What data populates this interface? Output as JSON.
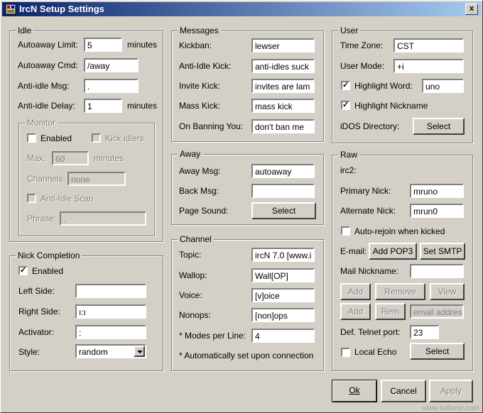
{
  "window": {
    "title": "IrcN Setup Settings",
    "close": "x"
  },
  "idle": {
    "legend": "Idle",
    "autoaway_limit_label": "Autoaway Limit:",
    "autoaway_limit_value": "5",
    "autoaway_limit_unit": "minutes",
    "autoaway_cmd_label": "Autoaway Cmd:",
    "autoaway_cmd_value": "/away",
    "antiidle_msg_label": "Anti-idle Msg:",
    "antiidle_msg_value": ".",
    "antiidle_delay_label": "Anti-idle Delay:",
    "antiidle_delay_value": "1",
    "antiidle_delay_unit": "minutes",
    "monitor": {
      "legend": "Monitor",
      "enabled_label": "Enabled",
      "kick_idlers_label": "Kick idlers",
      "max_label": "Max:",
      "max_value": "60",
      "max_unit": "minutes",
      "channels_label": "Channels:",
      "channels_value": "none",
      "antiidle_scan_label": "Anti-Idle Scan",
      "phrase_label": "Phrase:",
      "phrase_value": "."
    }
  },
  "nick": {
    "legend": "Nick Completion",
    "enabled_label": "Enabled",
    "left_label": "Left Side:",
    "left_value": "",
    "right_label": "Right Side:",
    "right_value": "ı:ı",
    "activator_label": "Activator:",
    "activator_value": ":",
    "style_label": "Style:",
    "style_value": "random"
  },
  "messages": {
    "legend": "Messages",
    "kickban_label": "Kickban:",
    "kickban_value": "lewser",
    "antiidle_kick_label": "Anti-Idle Kick:",
    "antiidle_kick_value": "anti-idles suck",
    "invite_kick_label": "Invite Kick:",
    "invite_kick_value": "invites are lam",
    "mass_kick_label": "Mass Kick:",
    "mass_kick_value": "mass kick",
    "banning_label": "On Banning You:",
    "banning_value": "don't ban me"
  },
  "away": {
    "legend": "Away",
    "away_msg_label": "Away Msg:",
    "away_msg_value": "autoaway",
    "back_msg_label": "Back Msg:",
    "back_msg_value": "",
    "page_sound_label": "Page Sound:",
    "select_label": "Select"
  },
  "channel": {
    "legend": "Channel",
    "topic_label": "Topic:",
    "topic_value": "ircN 7.0 [www.i",
    "wallop_label": "Wallop:",
    "wallop_value": "Wall[OP]",
    "voice_label": "Voice:",
    "voice_value": "[v]oice",
    "nonops_label": "Nonops:",
    "nonops_value": "[non]ops",
    "modes_label": "* Modes per Line:",
    "modes_value": "4",
    "note": "* Automatically set upon connection"
  },
  "user": {
    "legend": "User",
    "timezone_label": "Time Zone:",
    "timezone_value": "CST",
    "usermode_label": "User Mode:",
    "usermode_value": "+i",
    "highlight_word_label": "Highlight Word:",
    "highlight_word_value": "uno",
    "highlight_nick_label": "Highlight Nickname",
    "idos_label": "iDOS Directory:",
    "select_label": "Select"
  },
  "raw": {
    "legend": "Raw",
    "network": "irc2:",
    "primary_label": "Primary Nick:",
    "primary_value": "mruno",
    "alternate_label": "Alternate Nick:",
    "alternate_value": "mrun0",
    "autorejoin_label": "Auto-rejoin when kicked",
    "email_label": "E-mail:",
    "add_pop3": "Add POP3",
    "set_smtp": "Set SMTP",
    "mail_nick_label": "Mail Nickname:",
    "mail_nick_value": "",
    "add1": "Add",
    "remove": "Remove",
    "view": "View",
    "add2": "Add",
    "rem": "Rem",
    "email_addr_value": "email addres",
    "telnet_label": "Def. Telnet port:",
    "telnet_value": "23",
    "local_echo_label": "Local Echo",
    "select_label": "Select"
  },
  "footer": {
    "ok": "Ok",
    "cancel": "Cancel",
    "apply": "Apply",
    "watermark": "www.softonic.com"
  }
}
